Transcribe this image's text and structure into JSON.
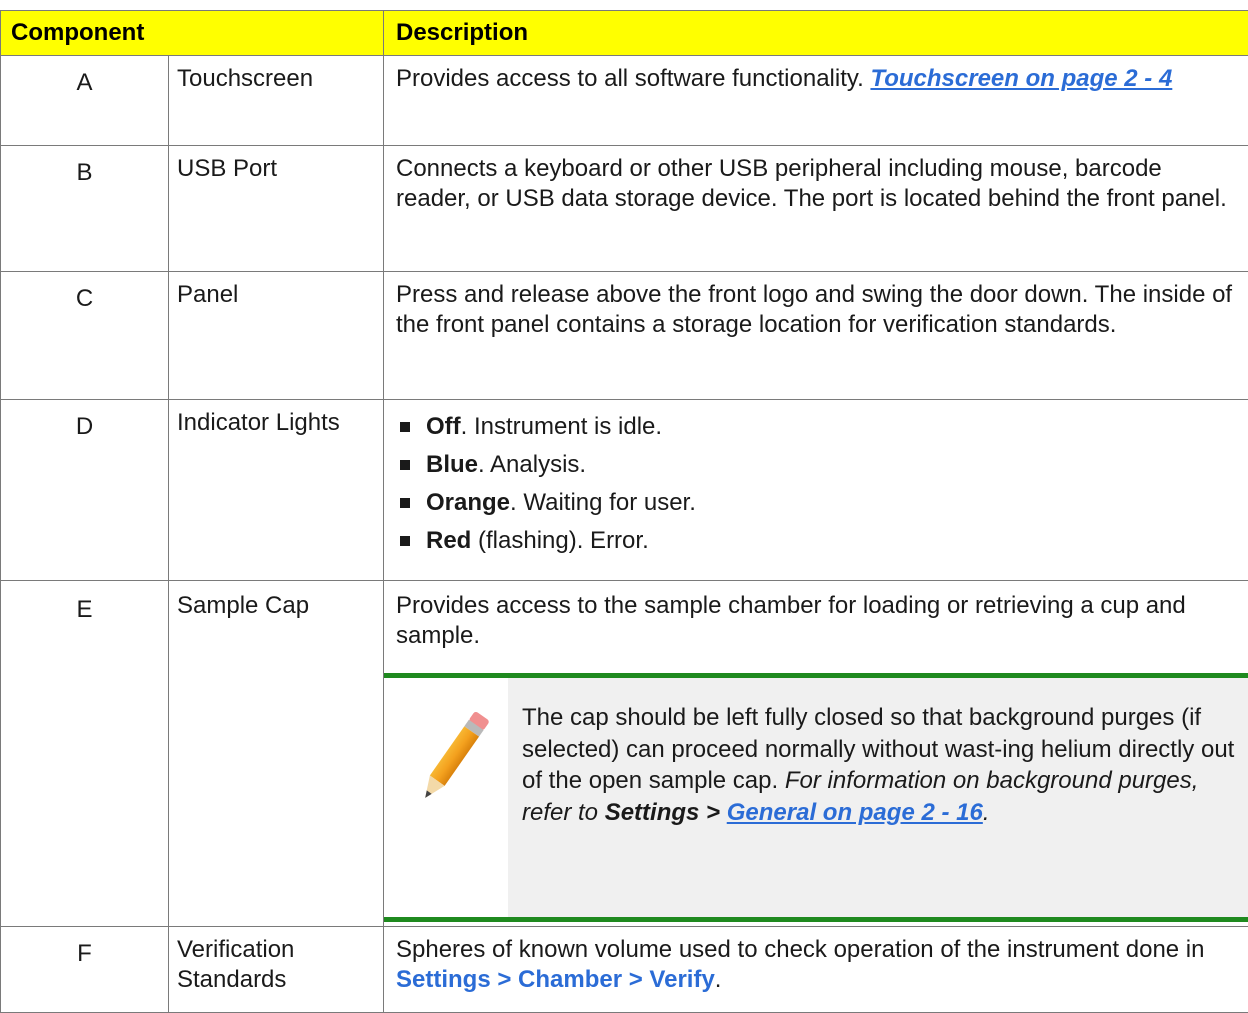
{
  "header": {
    "component": "Component",
    "description": "Description"
  },
  "rows": [
    {
      "letter": "A",
      "name": "Touchscreen",
      "desc_text": "Provides access to all software functionality. ",
      "desc_link": "Touchscreen on page 2 - 4"
    },
    {
      "letter": "B",
      "name": "USB Port",
      "desc_text": "Connects a keyboard or other USB peripheral including mouse, barcode reader, or USB data storage device. The port is located behind the front panel."
    },
    {
      "letter": "C",
      "name": "Panel",
      "desc_text": "Press and release above the front logo and swing the door down. The inside of the front panel contains a storage location for verification standards."
    },
    {
      "letter": "D",
      "name": "Indicator Lights",
      "lights": [
        {
          "bold": "Off",
          "rest": ". Instrument is idle."
        },
        {
          "bold": "Blue",
          "rest": ". Analysis."
        },
        {
          "bold": "Orange",
          "rest": ". Waiting for user."
        },
        {
          "bold": "Red",
          "rest": " (flashing). Error."
        }
      ]
    },
    {
      "letter": "E",
      "name": "Sample Cap",
      "desc_text": "Provides access to the sample chamber for loading or retrieving a cup and sample.",
      "note": {
        "icon": "pencil-icon",
        "text": "The cap should be left fully closed so that background purges (if selected) can proceed normally without wast-ing helium directly out of the open sample cap. ",
        "italic_text": "For information on background purges, refer to ",
        "bold_ref": "Settings > ",
        "link": "General on page 2 - 16",
        "end": "."
      }
    },
    {
      "letter": "F",
      "name": "Verification Standards",
      "desc_text": "Spheres of known volume used to check operation of the instrument done in ",
      "desc_link": "Settings > Chamber > Verify",
      "desc_end": "."
    }
  ],
  "colors": {
    "header_bg": "#ffff00",
    "link": "#2b6cd6",
    "note_rule": "#1f8a1f",
    "note_bg": "#f0f0f0"
  }
}
